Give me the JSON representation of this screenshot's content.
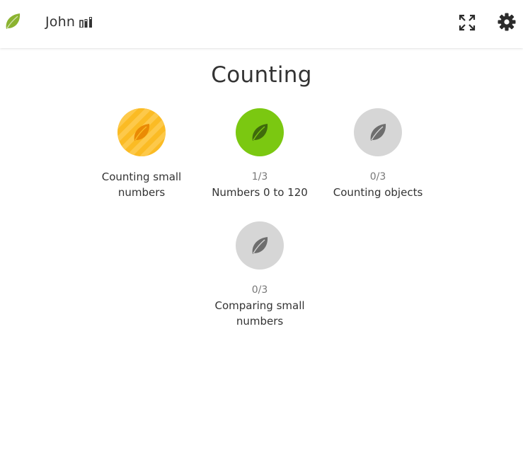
{
  "header": {
    "user_name": "John",
    "logo_icon": "leaf-logo-icon",
    "stats_icon": "bar-chart-icon",
    "fullscreen_icon": "fullscreen-icon",
    "settings_icon": "gear-icon",
    "logo_color": "#8bb330"
  },
  "page": {
    "title": "Counting"
  },
  "skills": [
    {
      "progress": "",
      "label": "Counting small numbers",
      "state": "in-progress",
      "color": "#fbbb24"
    },
    {
      "progress": "1/3",
      "label": "Numbers 0 to 120",
      "state": "active",
      "color": "#7bc811"
    },
    {
      "progress": "0/3",
      "label": "Counting objects",
      "state": "locked",
      "color": "#d6d6d6"
    },
    {
      "progress": "0/3",
      "label": "Comparing small numbers",
      "state": "locked",
      "color": "#d6d6d6"
    }
  ]
}
